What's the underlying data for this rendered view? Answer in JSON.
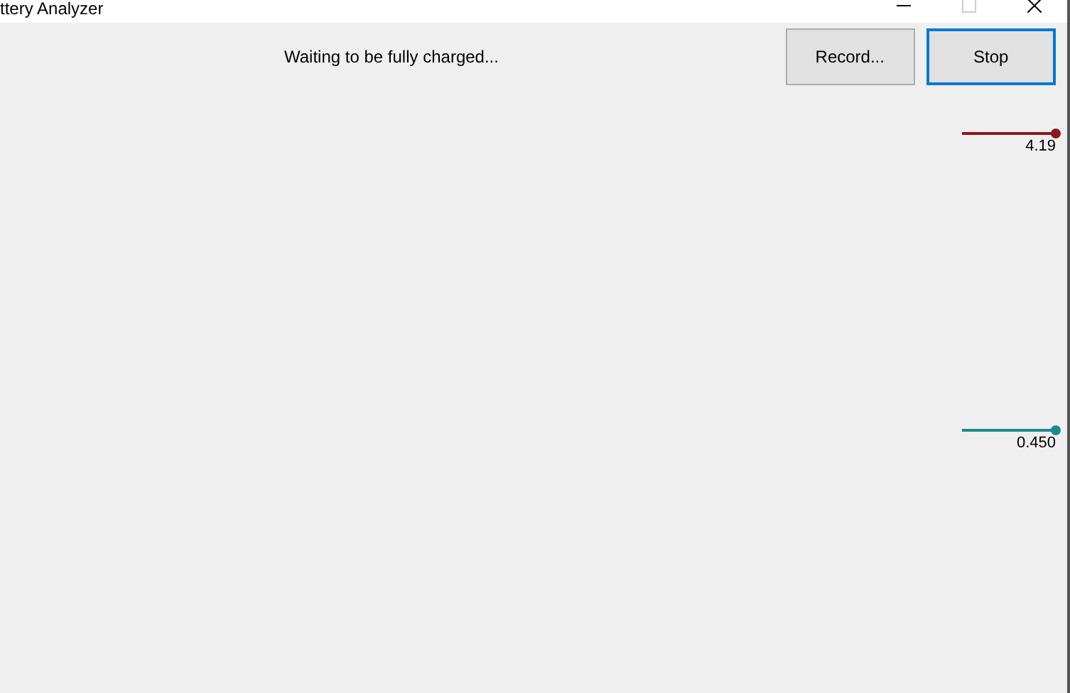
{
  "window": {
    "title": "ttery Analyzer"
  },
  "status": "Waiting to be fully charged...",
  "buttons": [
    {
      "label": "Record...",
      "focused": false
    },
    {
      "label": "Stop",
      "focused": true
    }
  ],
  "traces": [
    {
      "reading": "4.19",
      "color": "#8b1a1a"
    },
    {
      "reading": "0.450",
      "color": "#1a8b8b"
    }
  ]
}
